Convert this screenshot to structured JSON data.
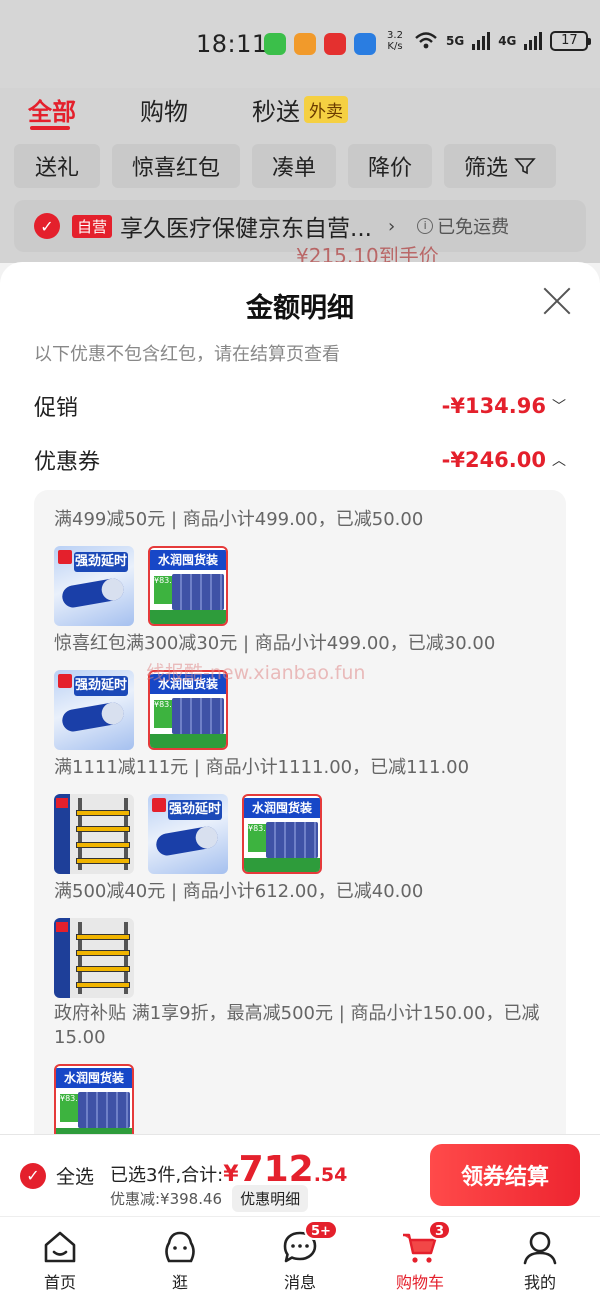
{
  "status": {
    "time": "18:11",
    "speed": "3.2 K/s",
    "sig1": "5G",
    "sig2": "4G",
    "battery": "17"
  },
  "tabs": [
    {
      "label": "全部",
      "active": true
    },
    {
      "label": "购物",
      "active": false
    },
    {
      "label": "秒送",
      "active": false,
      "tag": "外卖"
    }
  ],
  "filters": [
    "送礼",
    "惊喜红包",
    "凑单",
    "降价",
    "筛选"
  ],
  "shop": {
    "self_tag": "自营",
    "name": "享久医疗保健京东自营...",
    "shipping": "已免运费",
    "peek": "¥215.10到手价"
  },
  "sheet": {
    "title": "金额明细",
    "note": "以下优惠不包含红包，请在结算页查看",
    "promo": {
      "label": "促销",
      "amount": "-¥134.96"
    },
    "coupon": {
      "label": "优惠券",
      "amount": "-¥246.00"
    },
    "rules": [
      "满499减50元 | 商品小计499.00，已减50.00",
      "惊喜红包满300减30元 | 商品小计499.00，已减30.00",
      "满1111减111元 | 商品小计1111.00，已减111.00",
      "满500减40元 | 商品小计612.00，已减40.00",
      "政府补贴 满1享9折，最高减500元 | 商品小计150.00，已减15.00"
    ],
    "product_labels": {
      "pill": "强劲延时",
      "box": "水润囤货装",
      "box_price": "¥83.5"
    },
    "watermark": "线报酷-new.xianbao.fun"
  },
  "summary": {
    "select_all": "全选",
    "selected": "已选3件,合计:",
    "currency": "¥",
    "total_int": "712",
    "total_dec": ".54",
    "discount": "优惠减:¥398.46",
    "detail_btn": "优惠明细",
    "checkout": "领券结算"
  },
  "nav": [
    {
      "label": "首页",
      "icon": "home-icon"
    },
    {
      "label": "逛",
      "icon": "browse-icon"
    },
    {
      "label": "消息",
      "icon": "message-icon",
      "badge": "5+"
    },
    {
      "label": "购物车",
      "icon": "cart-icon",
      "badge": "3",
      "active": true
    },
    {
      "label": "我的",
      "icon": "profile-icon"
    }
  ],
  "colors": {
    "accent": "#e4202c",
    "overlay": "#d6d6d6"
  }
}
